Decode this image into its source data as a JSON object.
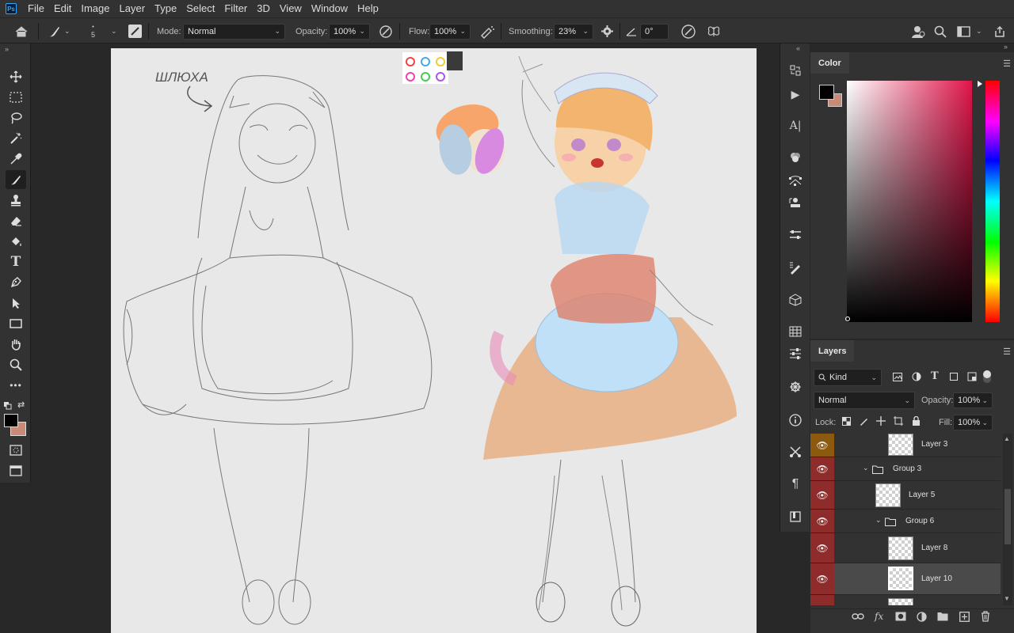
{
  "app": {
    "logo": "Ps"
  },
  "menu": [
    "File",
    "Edit",
    "Image",
    "Layer",
    "Type",
    "Select",
    "Filter",
    "3D",
    "View",
    "Window",
    "Help"
  ],
  "options": {
    "brush_size": "5",
    "mode_label": "Mode:",
    "mode_value": "Normal",
    "opacity_label": "Opacity:",
    "opacity_value": "100%",
    "flow_label": "Flow:",
    "flow_value": "100%",
    "smoothing_label": "Smoothing:",
    "smoothing_value": "23%",
    "angle_value": "0°"
  },
  "canvas": {
    "annotation_text": "ШЛЮХА",
    "colors": {
      "orange": "#f7a56a",
      "blue": "#b7cde2",
      "purple": "#d88ae0",
      "cream": "#f1e2d0",
      "apron": "#bfe0f6",
      "skirt": "#e8b28a"
    }
  },
  "color_panel": {
    "tab": "Color",
    "foreground": "#000000",
    "background": "#c98a78",
    "hue_color": "#e0154a"
  },
  "layers_panel": {
    "tab": "Layers",
    "filter_kind": "Kind",
    "blend_mode": "Normal",
    "opacity_label": "Opacity:",
    "opacity_value": "100%",
    "lock_label": "Lock:",
    "fill_label": "Fill:",
    "fill_value": "100%",
    "layers": [
      {
        "name": "Layer 3",
        "type": "layer",
        "tag_color": "#8b5a0e"
      },
      {
        "name": "Group 3",
        "type": "group",
        "tag_color": "#8e2b2b"
      },
      {
        "name": "Layer 5",
        "type": "layer",
        "tag_color": "#8e2b2b"
      },
      {
        "name": "Group 6",
        "type": "group",
        "tag_color": "#8e2b2b"
      },
      {
        "name": "Layer 8",
        "type": "layer",
        "tag_color": "#8e2b2b"
      },
      {
        "name": "Layer 10",
        "type": "layer",
        "tag_color": "#8e2b2b",
        "selected": true
      }
    ]
  }
}
